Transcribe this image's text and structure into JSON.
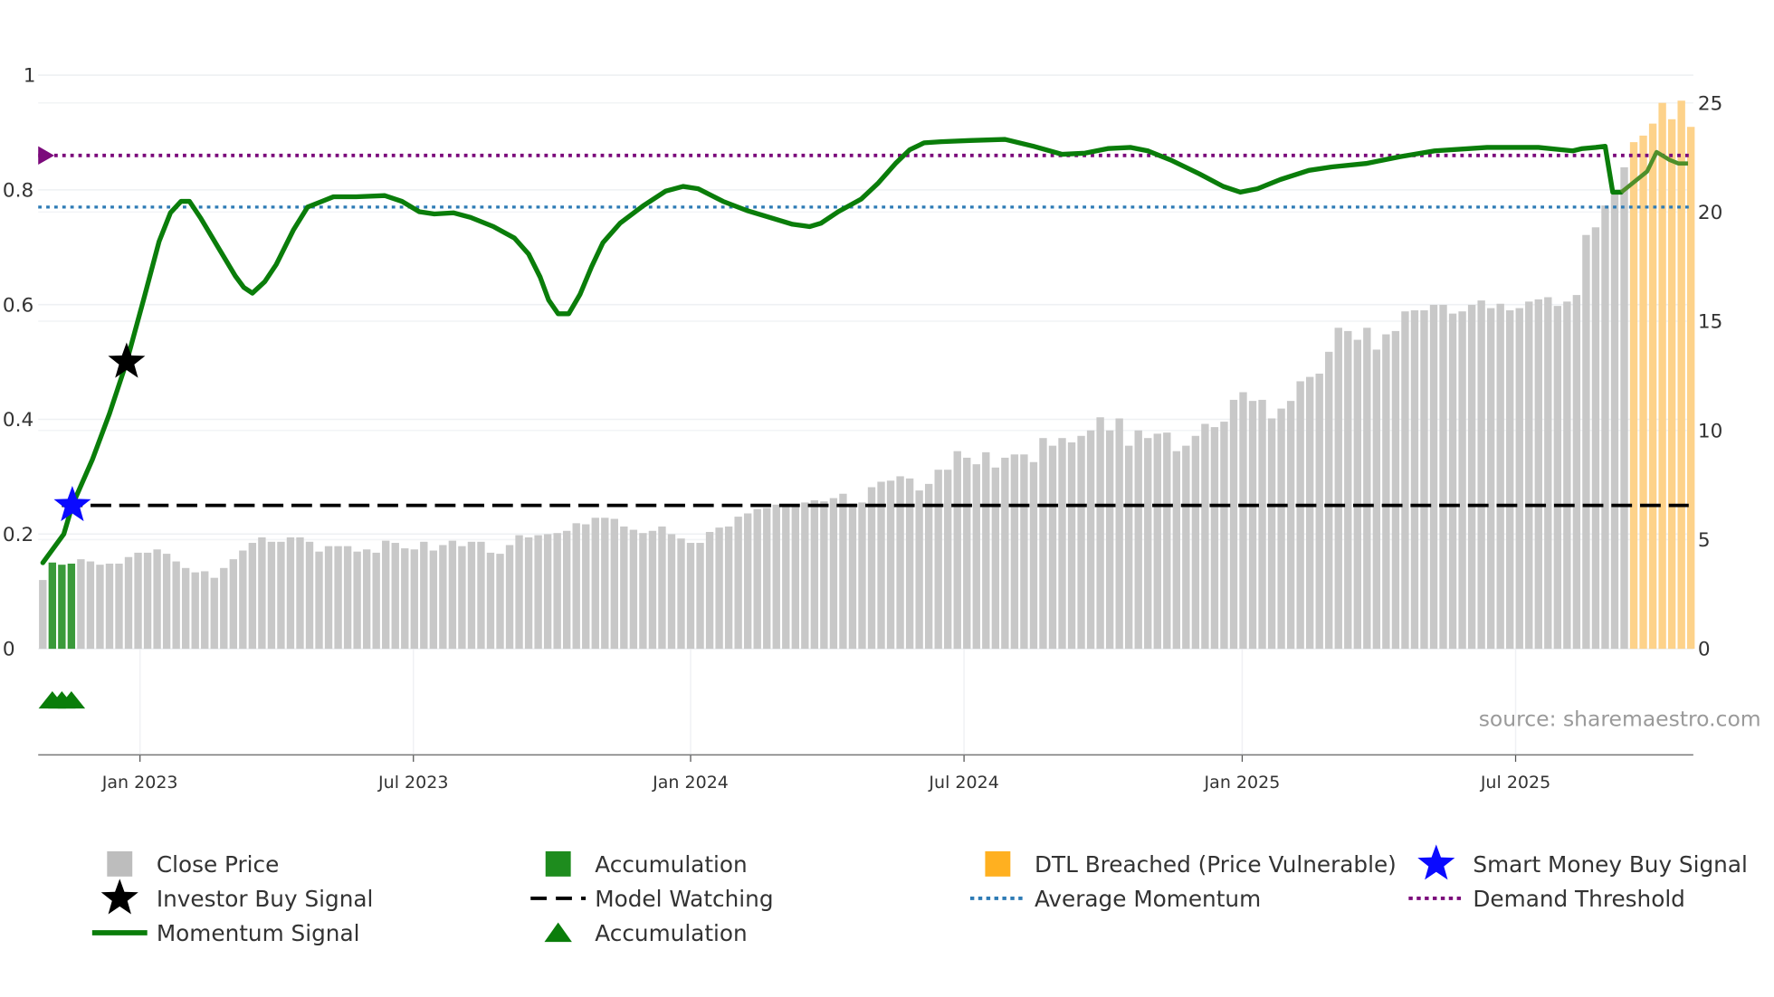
{
  "chart_data": {
    "type": "bar",
    "title": "",
    "x_unit": "week index",
    "left_axis": {
      "ylim": [
        -0.185,
        1.005
      ],
      "ticks": [
        0,
        0.2,
        0.4,
        0.6,
        0.8,
        1
      ],
      "tick_labels": [
        "0",
        "0.2",
        "0.4",
        "0.6",
        "0.8",
        "1"
      ]
    },
    "right_axis": {
      "ylim": [
        -4.86,
        26.4
      ],
      "ticks": [
        0,
        5,
        10,
        15,
        20,
        25
      ],
      "tick_labels": [
        "0",
        "5",
        "10",
        "15",
        "20",
        "25"
      ]
    },
    "x_ticks": [
      {
        "week": 10.2,
        "label": "Jan 2023"
      },
      {
        "week": 38.9,
        "label": "Jul 2023"
      },
      {
        "week": 68.0,
        "label": "Jan 2024"
      },
      {
        "week": 96.7,
        "label": "Jul 2024"
      },
      {
        "week": 125.9,
        "label": "Jan 2025"
      },
      {
        "week": 154.6,
        "label": "Jul 2025"
      }
    ],
    "close_price": [
      3.15,
      3.95,
      3.85,
      3.9,
      4.1,
      4.0,
      3.85,
      3.9,
      3.9,
      4.2,
      4.4,
      4.4,
      4.55,
      4.35,
      4.0,
      3.7,
      3.5,
      3.55,
      3.25,
      3.7,
      4.1,
      4.5,
      4.85,
      5.1,
      4.9,
      4.9,
      5.1,
      5.1,
      4.9,
      4.45,
      4.7,
      4.7,
      4.7,
      4.45,
      4.55,
      4.4,
      4.95,
      4.85,
      4.6,
      4.55,
      4.9,
      4.5,
      4.75,
      4.95,
      4.7,
      4.9,
      4.9,
      4.4,
      4.35,
      4.75,
      5.2,
      5.1,
      5.2,
      5.25,
      5.3,
      5.4,
      5.75,
      5.7,
      6.0,
      6.0,
      5.95,
      5.6,
      5.45,
      5.3,
      5.4,
      5.6,
      5.25,
      5.05,
      4.85,
      4.85,
      5.35,
      5.55,
      5.6,
      6.05,
      6.2,
      6.4,
      6.45,
      6.6,
      6.5,
      6.6,
      6.7,
      6.8,
      6.75,
      6.9,
      7.1,
      6.65,
      6.7,
      7.4,
      7.65,
      7.7,
      7.9,
      7.8,
      7.25,
      7.55,
      8.2,
      8.2,
      9.05,
      8.75,
      8.45,
      9.0,
      8.3,
      8.75,
      8.9,
      8.9,
      8.55,
      9.65,
      9.3,
      9.65,
      9.45,
      9.75,
      10.0,
      10.6,
      10.0,
      10.55,
      9.3,
      10.0,
      9.65,
      9.85,
      9.9,
      9.05,
      9.3,
      9.75,
      10.3,
      10.15,
      10.4,
      11.4,
      11.75,
      11.35,
      11.4,
      10.55,
      11.0,
      11.35,
      12.25,
      12.45,
      12.6,
      13.6,
      14.7,
      14.55,
      14.15,
      14.7,
      13.7,
      14.4,
      14.55,
      15.45,
      15.5,
      15.5,
      15.75,
      15.75,
      15.35,
      15.45,
      15.75,
      15.95,
      15.6,
      15.8,
      15.5,
      15.6,
      15.9,
      16.0,
      16.1,
      15.7,
      15.9,
      16.2,
      18.95,
      19.3,
      20.3,
      20.8,
      22.05,
      23.2,
      23.5,
      24.05,
      25.0,
      24.25,
      25.1,
      23.9
    ],
    "accumulation_bar_indices": [
      1,
      2,
      3
    ],
    "dtl_breached_count": 7,
    "momentum_signal": [
      [
        0,
        0.15
      ],
      [
        2.2,
        0.2
      ],
      [
        3.1,
        0.25
      ],
      [
        5.2,
        0.33
      ],
      [
        7,
        0.41
      ],
      [
        8.8,
        0.5
      ],
      [
        10.6,
        0.61
      ],
      [
        12.2,
        0.71
      ],
      [
        13.4,
        0.76
      ],
      [
        14.5,
        0.78
      ],
      [
        15.4,
        0.78
      ],
      [
        16.6,
        0.75
      ],
      [
        18.4,
        0.7
      ],
      [
        20.2,
        0.65
      ],
      [
        21.1,
        0.63
      ],
      [
        22,
        0.62
      ],
      [
        23.3,
        0.64
      ],
      [
        24.5,
        0.67
      ],
      [
        26.3,
        0.73
      ],
      [
        27.8,
        0.77
      ],
      [
        29.3,
        0.78
      ],
      [
        30.5,
        0.788
      ],
      [
        32.9,
        0.788
      ],
      [
        35.9,
        0.79
      ],
      [
        37.7,
        0.78
      ],
      [
        39.5,
        0.762
      ],
      [
        41.1,
        0.758
      ],
      [
        43.1,
        0.76
      ],
      [
        44.9,
        0.752
      ],
      [
        47.3,
        0.736
      ],
      [
        49.5,
        0.716
      ],
      [
        51,
        0.688
      ],
      [
        52.2,
        0.648
      ],
      [
        53.1,
        0.608
      ],
      [
        54.1,
        0.584
      ],
      [
        55.2,
        0.584
      ],
      [
        56.4,
        0.618
      ],
      [
        57.6,
        0.666
      ],
      [
        58.8,
        0.708
      ],
      [
        60.6,
        0.742
      ],
      [
        63,
        0.772
      ],
      [
        65.4,
        0.798
      ],
      [
        67.2,
        0.806
      ],
      [
        68.8,
        0.802
      ],
      [
        71.4,
        0.78
      ],
      [
        73.9,
        0.764
      ],
      [
        76.3,
        0.752
      ],
      [
        78.7,
        0.74
      ],
      [
        80.5,
        0.736
      ],
      [
        81.7,
        0.742
      ],
      [
        83.5,
        0.762
      ],
      [
        85.9,
        0.784
      ],
      [
        87.7,
        0.812
      ],
      [
        89.5,
        0.846
      ],
      [
        91,
        0.87
      ],
      [
        92.5,
        0.882
      ],
      [
        94.3,
        0.884
      ],
      [
        97.3,
        0.886
      ],
      [
        101,
        0.888
      ],
      [
        104,
        0.876
      ],
      [
        107,
        0.862
      ],
      [
        109.4,
        0.864
      ],
      [
        111.8,
        0.872
      ],
      [
        114.2,
        0.874
      ],
      [
        116,
        0.868
      ],
      [
        118.4,
        0.852
      ],
      [
        121.4,
        0.828
      ],
      [
        123.9,
        0.806
      ],
      [
        125.7,
        0.796
      ],
      [
        127.5,
        0.802
      ],
      [
        129.9,
        0.818
      ],
      [
        132.9,
        0.834
      ],
      [
        135.3,
        0.84
      ],
      [
        138.9,
        0.846
      ],
      [
        142.5,
        0.858
      ],
      [
        146.1,
        0.868
      ],
      [
        151.6,
        0.874
      ],
      [
        157,
        0.874
      ],
      [
        159.4,
        0.87
      ],
      [
        160.6,
        0.868
      ],
      [
        161.6,
        0.872
      ],
      [
        163,
        0.874
      ],
      [
        164,
        0.876
      ],
      [
        164.8,
        0.796
      ],
      [
        165.7,
        0.796
      ]
    ],
    "momentum_projection": [
      [
        165.7,
        0.796
      ],
      [
        166.6,
        0.808
      ],
      [
        168.4,
        0.832
      ],
      [
        169.4,
        0.866
      ],
      [
        170.8,
        0.852
      ],
      [
        171.7,
        0.846
      ],
      [
        172.7,
        0.846
      ]
    ],
    "average_momentum": 0.77,
    "demand_threshold": 0.86,
    "model_watching": 0.25,
    "model_watching_start_week": 2,
    "smart_money_buy_signal": {
      "week": 3.1,
      "value": 0.25
    },
    "investor_buy_signal": {
      "week": 8.8,
      "value": 0.5
    },
    "accumulation_markers": [
      {
        "week": 1,
        "value": -0.09
      },
      {
        "week": 2,
        "value": -0.09
      },
      {
        "week": 3,
        "value": -0.09
      }
    ],
    "legend": {
      "placement": "bottom",
      "entries": [
        {
          "label": "Close Price",
          "symbol": "square",
          "color": "#bdbdbd"
        },
        {
          "label": "Accumulation",
          "symbol": "square",
          "color": "#1e8c1e"
        },
        {
          "label": "DTL Breached (Price Vulnerable)",
          "symbol": "square",
          "color": "#ffb020"
        },
        {
          "label": "Smart Money Buy Signal",
          "symbol": "star",
          "color": "#0a0aff"
        },
        {
          "label": "Investor Buy Signal",
          "symbol": "star",
          "color": "#000000"
        },
        {
          "label": "Model Watching",
          "symbol": "dash",
          "color": "#000000"
        },
        {
          "label": "Average Momentum",
          "symbol": "dot",
          "color": "#2e7bb5"
        },
        {
          "label": "Demand Threshold",
          "symbol": "dot",
          "color": "#7b0a7b"
        },
        {
          "label": "Momentum Signal",
          "symbol": "line",
          "color": "#0a7d0a"
        },
        {
          "label": "Accumulation",
          "symbol": "triangle",
          "color": "#0a7d0a"
        }
      ]
    },
    "source": "source: sharemaestro.com"
  },
  "colors": {
    "close": "#c8c8c8",
    "accum": "#3a9a3a",
    "dtl": "#fdd28a",
    "momentum": "#0a7d0a",
    "projection": "#4f8f2a",
    "avg": "#2e7bb5",
    "demand": "#7b0a7b",
    "watch": "#000000",
    "smart": "#0a0aff",
    "investor": "#000000"
  }
}
